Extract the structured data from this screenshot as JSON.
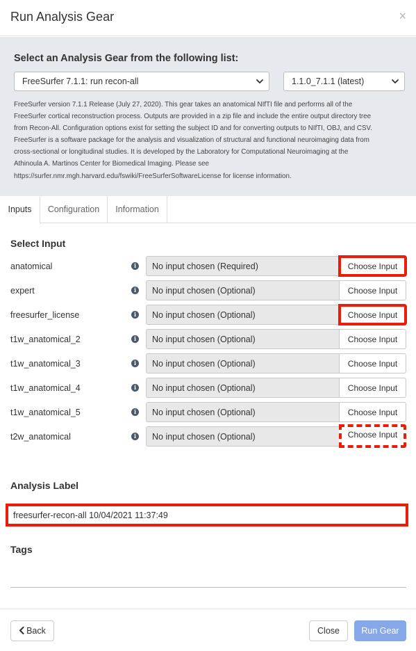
{
  "modal": {
    "title": "Run Analysis Gear",
    "close_symbol": "×"
  },
  "gear_panel": {
    "heading": "Select an Analysis Gear from the following list:",
    "gear_selected": "FreeSurfer 7.1.1: run recon-all",
    "version_selected": "1.1.0_7.1.1 (latest)",
    "description_lines": [
      "FreeSurfer version 7.1.1 Release (July 27, 2020). This gear takes an anatomical NIfTI file and performs all of the",
      "FreeSurfer cortical reconstruction process. Outputs are provided in a zip file and include the entire output directory tree",
      "from Recon-All. Configuration options exist for setting the subject ID and for converting outputs to NIfTI, OBJ, and CSV.",
      "FreeSurfer is a software package for the analysis and visualization of structural and functional neuroimaging data from",
      "cross-sectional or longitudinal studies. It is developed by the Laboratory for Computational Neuroimaging at the",
      "Athinoula A. Martinos Center for Biomedical Imaging. Please see",
      "https://surfer.nmr.mgh.harvard.edu/fswiki/FreeSurferSoftwareLicense for license information."
    ]
  },
  "tabs": [
    {
      "label": "Inputs",
      "active": true
    },
    {
      "label": "Configuration",
      "active": false
    },
    {
      "label": "Information",
      "active": false
    }
  ],
  "inputs_section": {
    "title": "Select Input",
    "info_glyph": "i",
    "rows": [
      {
        "name": "anatomical",
        "value": "No input chosen (Required)",
        "button": "Choose Input",
        "highlight": "solid"
      },
      {
        "name": "expert",
        "value": "No input chosen (Optional)",
        "button": "Choose Input",
        "highlight": "none"
      },
      {
        "name": "freesurfer_license",
        "value": "No input chosen (Optional)",
        "button": "Choose Input",
        "highlight": "solid"
      },
      {
        "name": "t1w_anatomical_2",
        "value": "No input chosen (Optional)",
        "button": "Choose Input",
        "highlight": "none"
      },
      {
        "name": "t1w_anatomical_3",
        "value": "No input chosen (Optional)",
        "button": "Choose Input",
        "highlight": "none"
      },
      {
        "name": "t1w_anatomical_4",
        "value": "No input chosen (Optional)",
        "button": "Choose Input",
        "highlight": "none"
      },
      {
        "name": "t1w_anatomical_5",
        "value": "No input chosen (Optional)",
        "button": "Choose Input",
        "highlight": "none"
      },
      {
        "name": "t2w_anatomical",
        "value": "No input chosen (Optional)",
        "button": "Choose Input",
        "highlight": "dashed"
      }
    ]
  },
  "analysis_label": {
    "title": "Analysis Label",
    "value": "freesurfer-recon-all 10/04/2021 11:37:49"
  },
  "tags": {
    "title": "Tags",
    "value": ""
  },
  "footer": {
    "back_label": "Back",
    "close_label": "Close",
    "run_label": "Run Gear"
  },
  "colors": {
    "highlight_red": "#ea1c0a",
    "run_button": "#86a8e8",
    "panel_bg": "#e6e9ee"
  },
  "icons": {
    "close": "close-icon",
    "dropdown": "chevron-updown-icon",
    "info": "info-icon",
    "back": "chevron-left-icon"
  }
}
